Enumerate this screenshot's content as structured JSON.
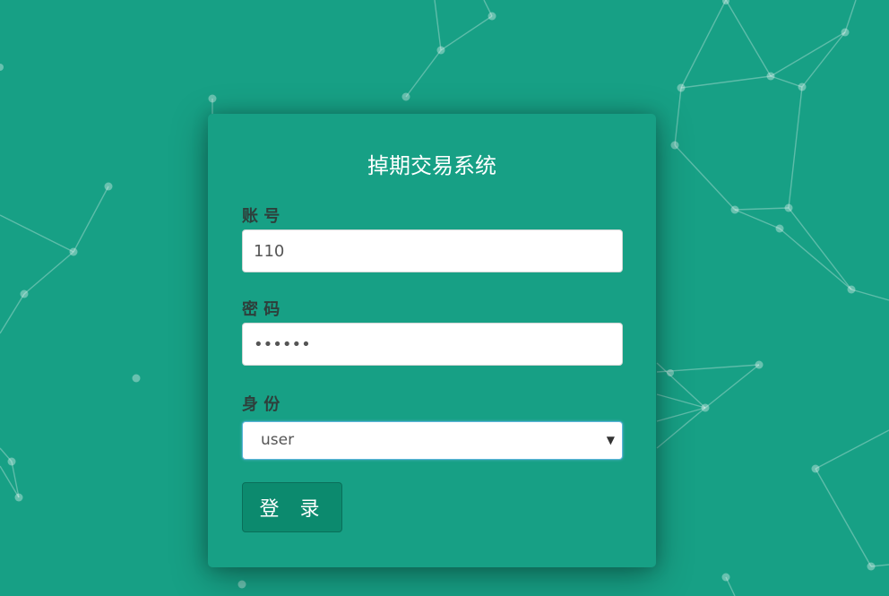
{
  "page": {
    "title": "掉期交易系统"
  },
  "form": {
    "account": {
      "label": "账 号",
      "value": "110"
    },
    "password": {
      "label": "密 码",
      "value": "••••••"
    },
    "role": {
      "label": "身 份",
      "selected": "user"
    },
    "submit_label": "登 录"
  },
  "colors": {
    "background": "#17a085",
    "button": "#0c8a6e",
    "label": "#2e3f3b"
  },
  "icons": {
    "select_arrow": "chevron-down-icon"
  }
}
